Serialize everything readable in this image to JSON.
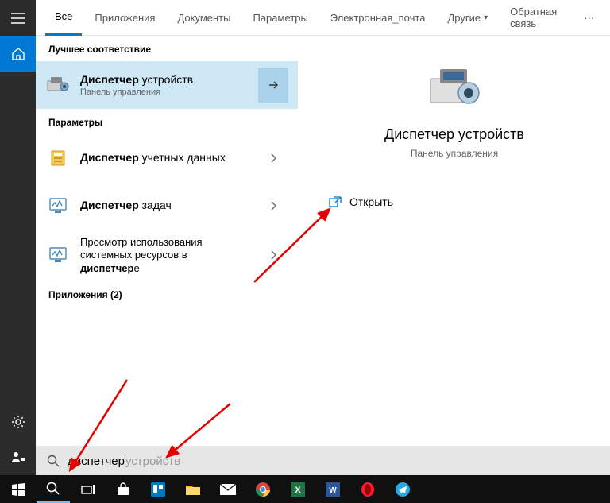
{
  "tabs": {
    "all": "Все",
    "apps": "Приложения",
    "docs": "Документы",
    "settings": "Параметры",
    "email": "Электронная_почта",
    "other": "Другие",
    "feedback": "Обратная связь"
  },
  "sections": {
    "best_match": "Лучшее соответствие",
    "settings": "Параметры",
    "apps_count": "Приложения (2)"
  },
  "results": {
    "r0": {
      "bold": "Диспетчер",
      "rest": " устройств",
      "sub": "Панель управления"
    },
    "r1": {
      "bold": "Диспетчер",
      "rest": " учетных данных"
    },
    "r2": {
      "bold": "Диспетчер",
      "rest": " задач"
    },
    "r3": {
      "line1": "Просмотр использования",
      "line2a": "системных ресурсов в ",
      "line2b": "диспетчер",
      "line2c": "е"
    }
  },
  "preview": {
    "title": "Диспетчер устройств",
    "sub": "Панель управления",
    "open": "Открыть"
  },
  "search": {
    "typed": "диспетчер",
    "ghost": "устройств"
  }
}
